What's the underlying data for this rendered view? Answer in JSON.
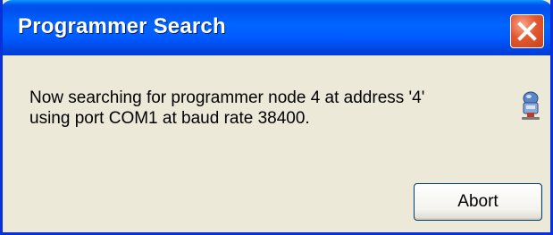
{
  "window": {
    "title": "Programmer Search"
  },
  "message": {
    "line1": "Now searching for programmer node 4 at address '4'",
    "line2": "using port COM1 at baud rate 38400."
  },
  "buttons": {
    "abort_label": "Abort"
  },
  "icons": {
    "close": "close-icon",
    "status": "network-node-icon"
  },
  "colors": {
    "titlebar": "#0058ee",
    "close_button": "#e3582f",
    "dialog_background": "#ece9d8"
  }
}
